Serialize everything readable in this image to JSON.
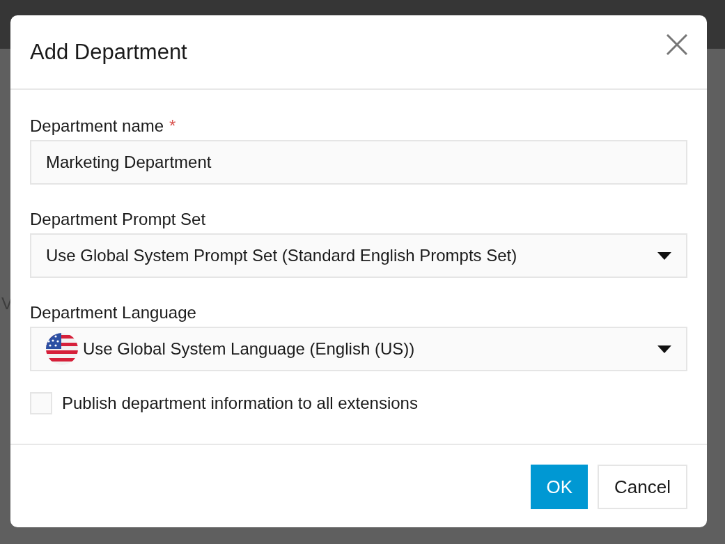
{
  "background": {
    "text_fragment": "V"
  },
  "dialog": {
    "title": "Add Department",
    "fields": [
      {
        "kind": "text",
        "label": "Department name",
        "required_mark": "*",
        "value": "Marketing Department"
      },
      {
        "kind": "select",
        "label": "Department Prompt Set",
        "value": "Use Global System Prompt Set (Standard English Prompts Set)",
        "flag": false
      },
      {
        "kind": "select",
        "label": "Department Language",
        "value": "Use Global System Language (English (US))",
        "flag": true
      }
    ],
    "checkbox": {
      "label": "Publish department information to all extensions",
      "checked": false
    },
    "buttons": [
      {
        "label": "OK",
        "kind": "primary"
      },
      {
        "label": "Cancel",
        "kind": "secondary"
      }
    ]
  }
}
